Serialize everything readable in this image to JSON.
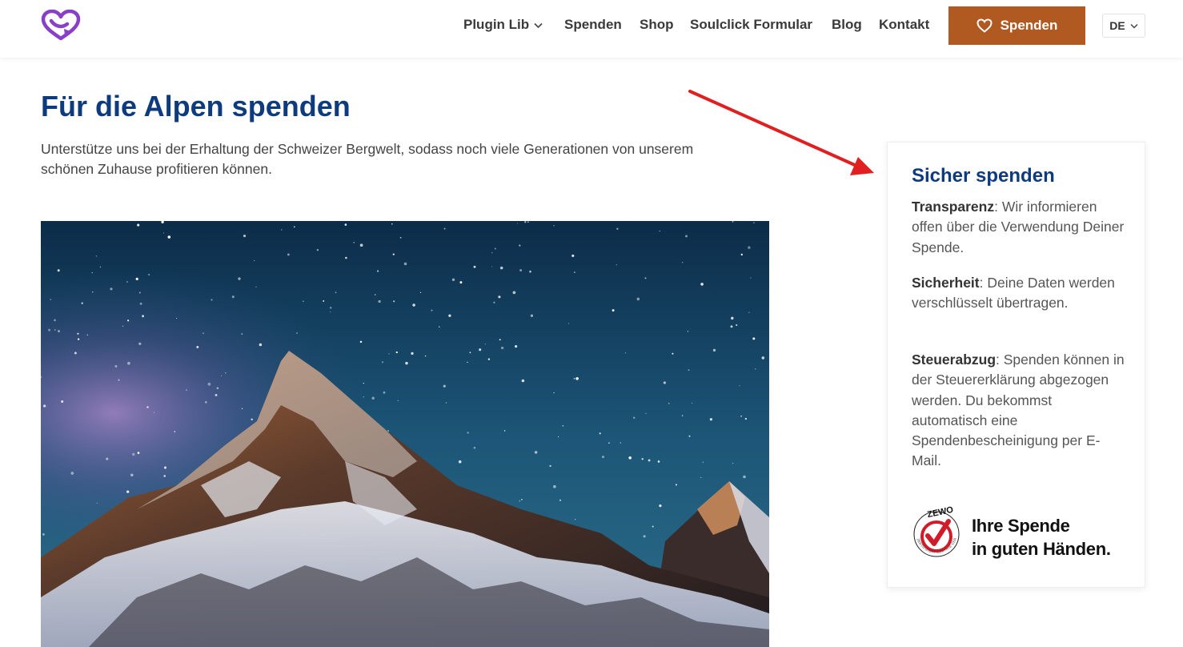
{
  "header": {
    "nav": [
      {
        "label": "Plugin Lib",
        "has_dropdown": true
      },
      {
        "label": "Spenden"
      },
      {
        "label": "Shop"
      },
      {
        "label": "Soulclick Formular"
      },
      {
        "label": "Blog"
      },
      {
        "label": "Kontakt"
      }
    ],
    "donate_button": "Spenden",
    "language": "DE"
  },
  "main": {
    "title": "Für die Alpen spenden",
    "intro": "Unterstütze uns bei der Erhaltung der Schweizer Bergwelt, sodass noch viele Generationen von unserem schönen Zuhause profitieren können."
  },
  "sidebar": {
    "title": "Sicher spenden",
    "items": [
      {
        "term": "Transparenz",
        "text": ": Wir informieren offen über die Verwendung Deiner Spende."
      },
      {
        "term": "Sicherheit",
        "text": ": Deine Daten werden verschlüsselt übertragen."
      },
      {
        "term": "Steuerabzug",
        "text": ": Spenden können in der Steuererklärung abgezogen werden. Du bekommst automatisch eine Spendenbescheinigung per E-Mail."
      }
    ],
    "badge": {
      "name": "ZEWO",
      "ring_text": "ZERTIFIZIERT CERTIFIÉ CERTIFICATO",
      "line1": "Ihre Spende",
      "line2": "in guten Händen."
    }
  },
  "colors": {
    "accent": "#b05a22",
    "heading": "#0e3b7d",
    "logo": "#8a3fc7",
    "arrow": "#e02020"
  }
}
